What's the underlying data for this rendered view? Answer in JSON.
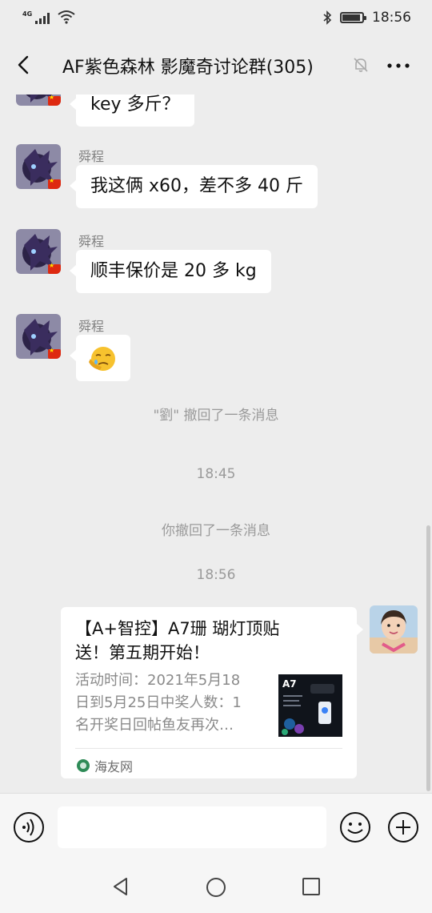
{
  "status_bar": {
    "network": "4G",
    "time": "18:56"
  },
  "header": {
    "title": "AF紫色森林 影魔奇讨论群(305)"
  },
  "messages": [
    {
      "type": "text",
      "side": "left",
      "sender": "",
      "text": "key 多斤？"
    },
    {
      "type": "text",
      "side": "left",
      "sender": "舜程",
      "text": "我这俩 x60，差不多 40 斤"
    },
    {
      "type": "text",
      "side": "left",
      "sender": "舜程",
      "text": "顺丰保价是 20 多 kg"
    },
    {
      "type": "emoji",
      "side": "left",
      "sender": "舜程",
      "emoji": "😭"
    },
    {
      "type": "system",
      "text": "\"劉\" 撤回了一条消息"
    },
    {
      "type": "time",
      "text": "18:45"
    },
    {
      "type": "system",
      "text": "你撤回了一条消息"
    },
    {
      "type": "time",
      "text": "18:56"
    }
  ],
  "card": {
    "title": "【A+智控】A7珊 瑚灯顶贴\n送！第五期开始！",
    "description": "活动时间：2021年5月18\n日到5月25日中奖人数：1\n名开奖日回帖鱼友再次…",
    "thumb_label": "A7",
    "source": "海友网"
  },
  "input": {
    "placeholder": ""
  },
  "colors": {
    "background": "#ededed",
    "bubble": "#ffffff",
    "flag": "#de2910"
  }
}
